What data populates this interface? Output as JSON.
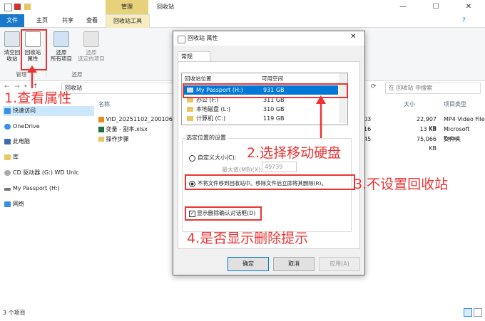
{
  "window": {
    "title": "回收站",
    "context_tab": "管理",
    "controls": {
      "minimize": "—",
      "maximize": "☐",
      "close": "✕"
    }
  },
  "ribbon": {
    "tabs": [
      "文件",
      "主页",
      "共享",
      "查看"
    ],
    "context_tab_label": "回收站工具",
    "buttons": [
      {
        "line1": "清空回",
        "line2": "收站"
      },
      {
        "line1": "回收站",
        "line2": "属性"
      },
      {
        "line1": "还原",
        "line2": "所有项目"
      },
      {
        "line1": "还原",
        "line2": "选定的项目"
      }
    ],
    "groups": [
      "管理",
      "还原"
    ]
  },
  "address": {
    "path": "回收站",
    "search_placeholder": "在 回收站 中搜索"
  },
  "nav": {
    "items": [
      {
        "label": "快速访问",
        "icon": "star-icon"
      },
      {
        "label": "OneDrive",
        "icon": "cloud-icon"
      },
      {
        "label": "此电脑",
        "icon": "computer-icon"
      },
      {
        "label": "库",
        "icon": "library-icon"
      },
      {
        "label": "CD 驱动器 (G:) WD Unlc",
        "icon": "cd-drive-icon"
      },
      {
        "label": "My Passport (H:)",
        "icon": "drive-icon"
      },
      {
        "label": "网络",
        "icon": "network-icon"
      }
    ]
  },
  "files": {
    "columns": {
      "name": "名称",
      "size": "大小",
      "type": "项目类型"
    },
    "rows": [
      {
        "name": "VID_20251102_200106...",
        "date": "03",
        "size": "22,907 KB",
        "type": "MP4 Video File"
      },
      {
        "name": "变量 - 副本.xlsx",
        "date": "16",
        "size": "13 KB",
        "type": "Microsoft Excel"
      },
      {
        "name": "操作步骤",
        "date": "45",
        "size": "75,066 KB",
        "type": "文件夹"
      }
    ],
    "status": "3 个项目"
  },
  "dialog": {
    "title": "回收站 属性",
    "tab": "常规",
    "list_headers": {
      "location": "回收站位置",
      "space": "可用空间"
    },
    "locations": [
      {
        "name": "My Passport (H:)",
        "space": "931 GB"
      },
      {
        "name": "办公 (F:)",
        "space": "311 GB"
      },
      {
        "name": "本地磁盘 (L:)",
        "space": "310 GB"
      },
      {
        "name": "计算机 (C:)",
        "space": "119 GB"
      }
    ],
    "settings_label": "选定位置的设置",
    "custom_size": "自定义大小(C):",
    "max_size_label": "最大值(MB)(X):",
    "max_size_value": "49739",
    "no_recycle": "不将文件移到回收站中。移除文件后立即将其删除(R)。",
    "confirm_dialog": "显示删除确认对话框(D)",
    "buttons": {
      "ok": "确定",
      "cancel": "取消",
      "apply": "应用(A)"
    }
  },
  "annotations": {
    "step1": "1.查看属性",
    "step2": "2.选择移动硬盘",
    "step3": "3.不设置回收站",
    "step4": "4.是否显示删除提示",
    "color": "#e33333"
  }
}
